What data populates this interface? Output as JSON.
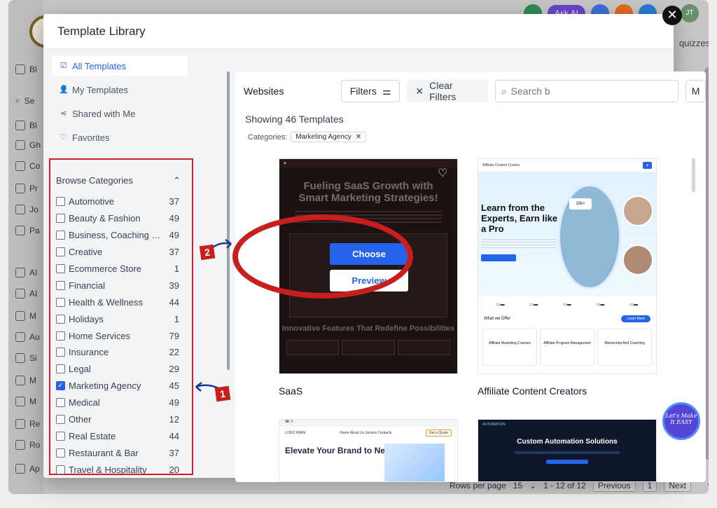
{
  "background": {
    "top_pill": "Ask AI",
    "quizzes_label": "quizzes",
    "sidebar_items": [
      "Bl",
      "Se",
      "Bl",
      "Gh",
      "Co",
      "Pr",
      "Jo",
      "Pa",
      "AI",
      "AI",
      "M",
      "Au",
      "Si",
      "M",
      "M",
      "Re",
      "Ro",
      "Ap"
    ],
    "footer": {
      "rows_per_page_label": "Rows per page",
      "rows_value": "15",
      "range": "1 - 12 of 12",
      "previous": "Previous",
      "page": "1",
      "next": "Next"
    }
  },
  "modal": {
    "title": "Template Library",
    "close_symbol": "✕",
    "avatar": "JT",
    "nav": [
      {
        "label": "All Templates",
        "icon": "checkbox-icon",
        "active": true
      },
      {
        "label": "My Templates",
        "icon": "user-icon",
        "active": false
      },
      {
        "label": "Shared with Me",
        "icon": "share-icon",
        "active": false
      },
      {
        "label": "Favorites",
        "icon": "heart-icon",
        "active": false
      }
    ],
    "browse_categories_label": "Browse Categories",
    "categories": [
      {
        "name": "Automotive",
        "count": "37",
        "checked": false
      },
      {
        "name": "Beauty & Fashion",
        "count": "49",
        "checked": false
      },
      {
        "name": "Business, Coaching & Consulting",
        "count": "49",
        "checked": false
      },
      {
        "name": "Creative",
        "count": "37",
        "checked": false
      },
      {
        "name": "Ecommerce Store",
        "count": "1",
        "checked": false
      },
      {
        "name": "Financial",
        "count": "39",
        "checked": false
      },
      {
        "name": "Health & Wellness",
        "count": "44",
        "checked": false
      },
      {
        "name": "Holidays",
        "count": "1",
        "checked": false
      },
      {
        "name": "Home Services",
        "count": "79",
        "checked": false
      },
      {
        "name": "Insurance",
        "count": "22",
        "checked": false
      },
      {
        "name": "Legal",
        "count": "29",
        "checked": false
      },
      {
        "name": "Marketing Agency",
        "count": "45",
        "checked": true
      },
      {
        "name": "Medical",
        "count": "49",
        "checked": false
      },
      {
        "name": "Other",
        "count": "12",
        "checked": false
      },
      {
        "name": "Real Estate",
        "count": "44",
        "checked": false
      },
      {
        "name": "Restaurant & Bar",
        "count": "37",
        "checked": false
      },
      {
        "name": "Travel & Hospitality",
        "count": "20",
        "checked": false
      }
    ],
    "main": {
      "section_label": "Websites",
      "filters_label": "Filters",
      "clear_filters_label": "Clear Filters",
      "search_placeholder": "Search b",
      "more_label": "M",
      "showing_text": "Showing 46 Templates",
      "categories_label": "Categories:",
      "active_chip": "Marketing Agency",
      "cards": [
        {
          "name": "SaaS",
          "headline": "Fueling SaaS Growth with Smart Marketing Strategies!",
          "section_headline": "Innovative Features That Redefine Possibilities",
          "choose_label": "Choose",
          "preview_label": "Preview"
        },
        {
          "name": "Affiliate Content Creators",
          "brand": "Affiliate Content Creator",
          "headline": "Learn from the Experts, Earn like a Pro",
          "stat_badge": "15k+",
          "offer_title": "What we Offer",
          "offer_button": "Learn More",
          "tiles": [
            "Affiliate Marketing Courses",
            "Affiliate Program Management",
            "Mentorship And Coaching"
          ]
        },
        {
          "logo_text": "LOGO HERE",
          "nav": [
            "Home",
            "About Us",
            "Service",
            "Contacts"
          ],
          "quote_button": "Get a Quote",
          "headline": "Elevate Your Brand to New Heights"
        },
        {
          "brand": "AUTOMATION",
          "headline": "Custom Automation Solutions"
        }
      ]
    }
  },
  "annotations": {
    "step1": "1",
    "step2": "2",
    "color": "#c81e1e"
  },
  "widget": {
    "text": "Let's Make It EASY"
  },
  "colors": {
    "accent": "#2563eb",
    "annotation_red": "#d31f2a"
  }
}
